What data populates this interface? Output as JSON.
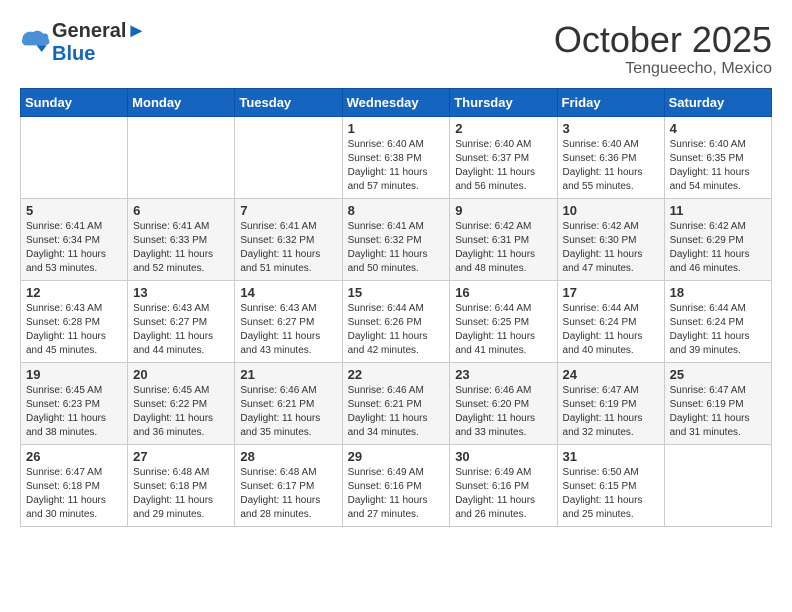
{
  "header": {
    "logo_line1": "General",
    "logo_line2": "Blue",
    "month": "October 2025",
    "location": "Tengueecho, Mexico"
  },
  "weekdays": [
    "Sunday",
    "Monday",
    "Tuesday",
    "Wednesday",
    "Thursday",
    "Friday",
    "Saturday"
  ],
  "weeks": [
    [
      {
        "day": "",
        "sunrise": "",
        "sunset": "",
        "daylight": ""
      },
      {
        "day": "",
        "sunrise": "",
        "sunset": "",
        "daylight": ""
      },
      {
        "day": "",
        "sunrise": "",
        "sunset": "",
        "daylight": ""
      },
      {
        "day": "1",
        "sunrise": "Sunrise: 6:40 AM",
        "sunset": "Sunset: 6:38 PM",
        "daylight": "Daylight: 11 hours and 57 minutes."
      },
      {
        "day": "2",
        "sunrise": "Sunrise: 6:40 AM",
        "sunset": "Sunset: 6:37 PM",
        "daylight": "Daylight: 11 hours and 56 minutes."
      },
      {
        "day": "3",
        "sunrise": "Sunrise: 6:40 AM",
        "sunset": "Sunset: 6:36 PM",
        "daylight": "Daylight: 11 hours and 55 minutes."
      },
      {
        "day": "4",
        "sunrise": "Sunrise: 6:40 AM",
        "sunset": "Sunset: 6:35 PM",
        "daylight": "Daylight: 11 hours and 54 minutes."
      }
    ],
    [
      {
        "day": "5",
        "sunrise": "Sunrise: 6:41 AM",
        "sunset": "Sunset: 6:34 PM",
        "daylight": "Daylight: 11 hours and 53 minutes."
      },
      {
        "day": "6",
        "sunrise": "Sunrise: 6:41 AM",
        "sunset": "Sunset: 6:33 PM",
        "daylight": "Daylight: 11 hours and 52 minutes."
      },
      {
        "day": "7",
        "sunrise": "Sunrise: 6:41 AM",
        "sunset": "Sunset: 6:32 PM",
        "daylight": "Daylight: 11 hours and 51 minutes."
      },
      {
        "day": "8",
        "sunrise": "Sunrise: 6:41 AM",
        "sunset": "Sunset: 6:32 PM",
        "daylight": "Daylight: 11 hours and 50 minutes."
      },
      {
        "day": "9",
        "sunrise": "Sunrise: 6:42 AM",
        "sunset": "Sunset: 6:31 PM",
        "daylight": "Daylight: 11 hours and 48 minutes."
      },
      {
        "day": "10",
        "sunrise": "Sunrise: 6:42 AM",
        "sunset": "Sunset: 6:30 PM",
        "daylight": "Daylight: 11 hours and 47 minutes."
      },
      {
        "day": "11",
        "sunrise": "Sunrise: 6:42 AM",
        "sunset": "Sunset: 6:29 PM",
        "daylight": "Daylight: 11 hours and 46 minutes."
      }
    ],
    [
      {
        "day": "12",
        "sunrise": "Sunrise: 6:43 AM",
        "sunset": "Sunset: 6:28 PM",
        "daylight": "Daylight: 11 hours and 45 minutes."
      },
      {
        "day": "13",
        "sunrise": "Sunrise: 6:43 AM",
        "sunset": "Sunset: 6:27 PM",
        "daylight": "Daylight: 11 hours and 44 minutes."
      },
      {
        "day": "14",
        "sunrise": "Sunrise: 6:43 AM",
        "sunset": "Sunset: 6:27 PM",
        "daylight": "Daylight: 11 hours and 43 minutes."
      },
      {
        "day": "15",
        "sunrise": "Sunrise: 6:44 AM",
        "sunset": "Sunset: 6:26 PM",
        "daylight": "Daylight: 11 hours and 42 minutes."
      },
      {
        "day": "16",
        "sunrise": "Sunrise: 6:44 AM",
        "sunset": "Sunset: 6:25 PM",
        "daylight": "Daylight: 11 hours and 41 minutes."
      },
      {
        "day": "17",
        "sunrise": "Sunrise: 6:44 AM",
        "sunset": "Sunset: 6:24 PM",
        "daylight": "Daylight: 11 hours and 40 minutes."
      },
      {
        "day": "18",
        "sunrise": "Sunrise: 6:44 AM",
        "sunset": "Sunset: 6:24 PM",
        "daylight": "Daylight: 11 hours and 39 minutes."
      }
    ],
    [
      {
        "day": "19",
        "sunrise": "Sunrise: 6:45 AM",
        "sunset": "Sunset: 6:23 PM",
        "daylight": "Daylight: 11 hours and 38 minutes."
      },
      {
        "day": "20",
        "sunrise": "Sunrise: 6:45 AM",
        "sunset": "Sunset: 6:22 PM",
        "daylight": "Daylight: 11 hours and 36 minutes."
      },
      {
        "day": "21",
        "sunrise": "Sunrise: 6:46 AM",
        "sunset": "Sunset: 6:21 PM",
        "daylight": "Daylight: 11 hours and 35 minutes."
      },
      {
        "day": "22",
        "sunrise": "Sunrise: 6:46 AM",
        "sunset": "Sunset: 6:21 PM",
        "daylight": "Daylight: 11 hours and 34 minutes."
      },
      {
        "day": "23",
        "sunrise": "Sunrise: 6:46 AM",
        "sunset": "Sunset: 6:20 PM",
        "daylight": "Daylight: 11 hours and 33 minutes."
      },
      {
        "day": "24",
        "sunrise": "Sunrise: 6:47 AM",
        "sunset": "Sunset: 6:19 PM",
        "daylight": "Daylight: 11 hours and 32 minutes."
      },
      {
        "day": "25",
        "sunrise": "Sunrise: 6:47 AM",
        "sunset": "Sunset: 6:19 PM",
        "daylight": "Daylight: 11 hours and 31 minutes."
      }
    ],
    [
      {
        "day": "26",
        "sunrise": "Sunrise: 6:47 AM",
        "sunset": "Sunset: 6:18 PM",
        "daylight": "Daylight: 11 hours and 30 minutes."
      },
      {
        "day": "27",
        "sunrise": "Sunrise: 6:48 AM",
        "sunset": "Sunset: 6:18 PM",
        "daylight": "Daylight: 11 hours and 29 minutes."
      },
      {
        "day": "28",
        "sunrise": "Sunrise: 6:48 AM",
        "sunset": "Sunset: 6:17 PM",
        "daylight": "Daylight: 11 hours and 28 minutes."
      },
      {
        "day": "29",
        "sunrise": "Sunrise: 6:49 AM",
        "sunset": "Sunset: 6:16 PM",
        "daylight": "Daylight: 11 hours and 27 minutes."
      },
      {
        "day": "30",
        "sunrise": "Sunrise: 6:49 AM",
        "sunset": "Sunset: 6:16 PM",
        "daylight": "Daylight: 11 hours and 26 minutes."
      },
      {
        "day": "31",
        "sunrise": "Sunrise: 6:50 AM",
        "sunset": "Sunset: 6:15 PM",
        "daylight": "Daylight: 11 hours and 25 minutes."
      },
      {
        "day": "",
        "sunrise": "",
        "sunset": "",
        "daylight": ""
      }
    ]
  ]
}
